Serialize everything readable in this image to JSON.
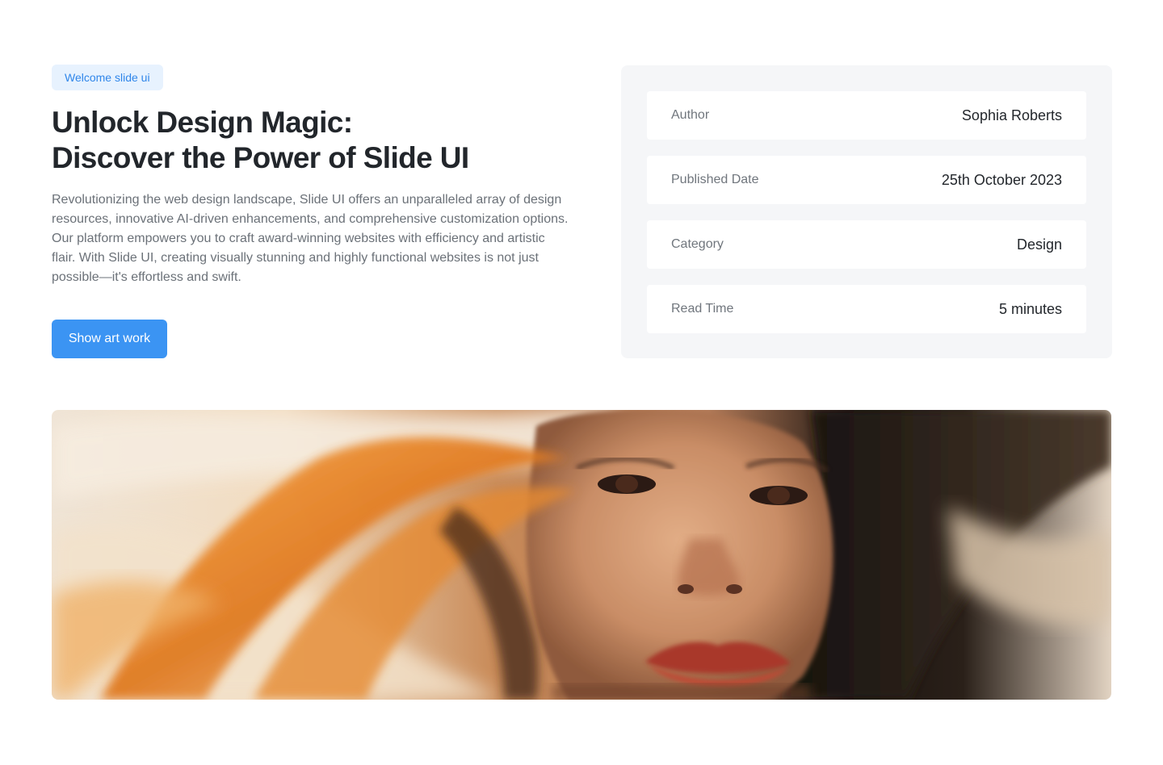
{
  "hero": {
    "badge": "Welcome slide ui",
    "title_line1": "Unlock Design Magic:",
    "title_line2": "Discover the Power of Slide UI",
    "description": "Revolutionizing the web design landscape, Slide UI offers an unparalleled array of design resources, innovative AI-driven enhancements, and comprehensive customization options. Our platform empowers you to craft award-winning websites with efficiency and artistic flair. With Slide UI, creating visually stunning and highly functional websites is not just possible—it's effortless and swift.",
    "cta_label": "Show art work"
  },
  "meta": {
    "rows": [
      {
        "label": "Author",
        "value": "Sophia Roberts"
      },
      {
        "label": "Published Date",
        "value": "25th October 2023"
      },
      {
        "label": "Category",
        "value": "Design"
      },
      {
        "label": "Read Time",
        "value": "5 minutes"
      }
    ]
  },
  "banner": {
    "alt": ""
  },
  "colors": {
    "accent": "#3b94f3",
    "badge_bg": "#e7f2fe",
    "badge_text": "#2f86ea",
    "card_bg": "#f5f6f8"
  }
}
